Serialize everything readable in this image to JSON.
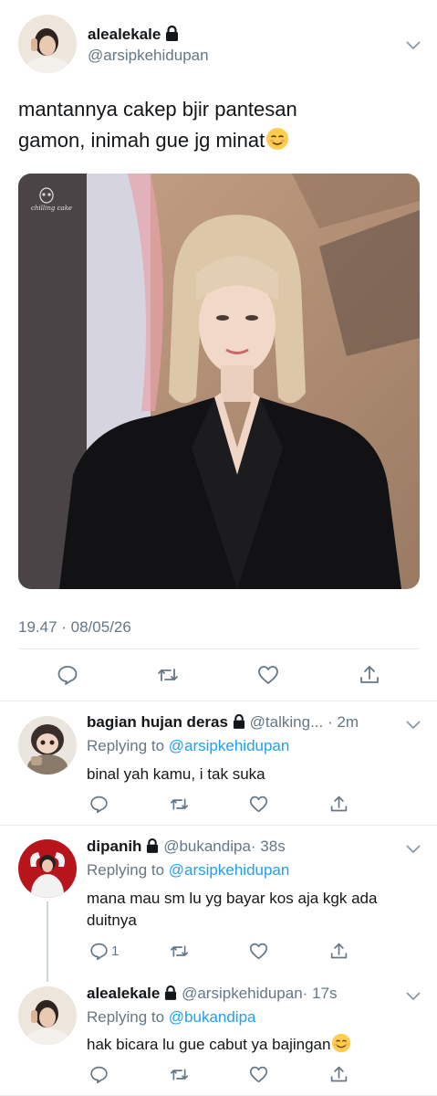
{
  "main_tweet": {
    "display_name": "alealekale",
    "handle": "@arsipkehidupan",
    "text_line1": "mantannya cakep bjir pantesan",
    "text_line2": "gamon, inimah gue jg minat",
    "timestamp": "19.47 · 08/05/26",
    "photo_watermark": "chilling cake"
  },
  "replies": [
    {
      "display_name": "bagian hujan deras",
      "handle": "@talking...",
      "time": "· 2m",
      "replying_prefix": "Replying to ",
      "replying_to": "@arsipkehidupan",
      "text": "binal yah kamu, i tak suka",
      "reply_count": ""
    },
    {
      "display_name": "dipanih",
      "handle": "@bukandipa",
      "time": "· 38s",
      "replying_prefix": "Replying to ",
      "replying_to": "@arsipkehidupan",
      "text_line1": "mana mau sm lu yg bayar kos aja kgk ada",
      "text_line2": "duitnya",
      "reply_count": "1"
    },
    {
      "display_name": "alealekale",
      "handle": "@arsipkehidupan",
      "time": "· 17s",
      "replying_prefix": "Replying to ",
      "replying_to": "@bukandipa",
      "text": "hak bicara lu gue cabut ya bajingan",
      "reply_count": ""
    }
  ],
  "colors": {
    "link": "#1da1f2",
    "secondary": "#657786",
    "divider": "#e6ecf0"
  }
}
